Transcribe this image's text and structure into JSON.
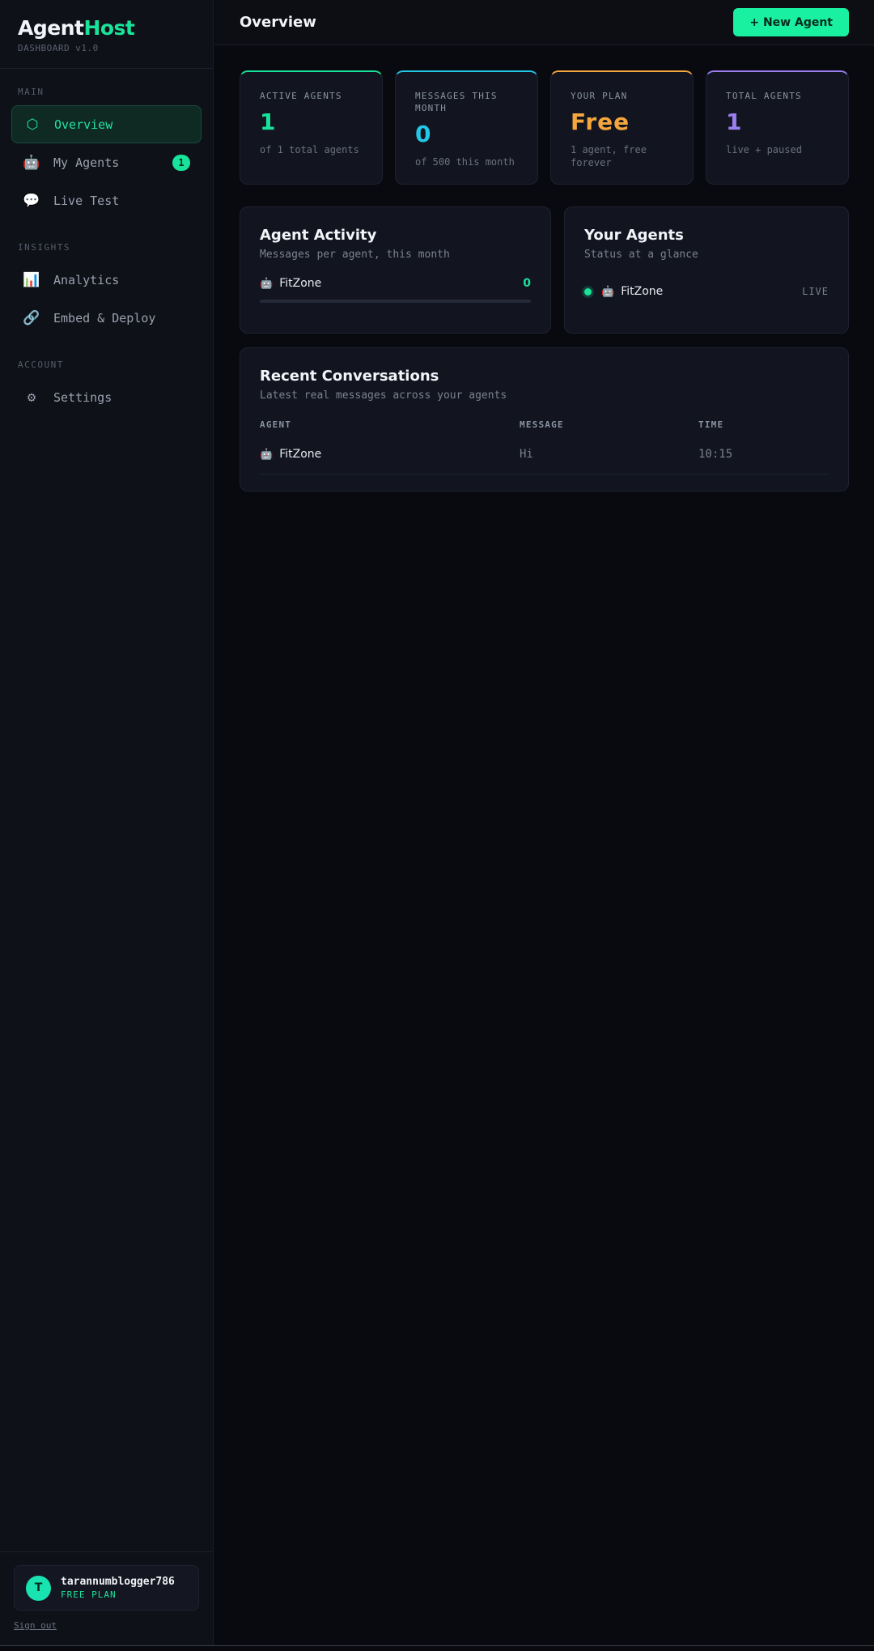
{
  "brand": {
    "name_part1": "Agent",
    "name_part2": "Host",
    "subtitle": "DASHBOARD v1.0"
  },
  "sidebar": {
    "sections": [
      {
        "label": "MAIN",
        "items": [
          {
            "label": "Overview",
            "icon": "hexagon-icon",
            "glyph": "⬡",
            "active": true
          },
          {
            "label": "My Agents",
            "icon": "robot-icon",
            "glyph": "🤖",
            "badge": "1"
          },
          {
            "label": "Live Test",
            "icon": "chat-bubble-icon",
            "glyph": "💬"
          }
        ]
      },
      {
        "label": "INSIGHTS",
        "items": [
          {
            "label": "Analytics",
            "icon": "bar-chart-icon",
            "glyph": "📊"
          },
          {
            "label": "Embed & Deploy",
            "icon": "link-icon",
            "glyph": "🔗"
          }
        ]
      },
      {
        "label": "ACCOUNT",
        "items": [
          {
            "label": "Settings",
            "icon": "gear-icon",
            "glyph": "⚙"
          }
        ]
      }
    ]
  },
  "user": {
    "initial": "T",
    "name": "tarannumblogger786",
    "plan": "FREE PLAN",
    "sign_out": "Sign out"
  },
  "topbar": {
    "title": "Overview",
    "new_agent_label": "+ New Agent"
  },
  "stats": [
    {
      "label": "ACTIVE AGENTS",
      "value": "1",
      "sub": "of 1 total agents",
      "color": "#19e39a"
    },
    {
      "label": "MESSAGES THIS MONTH",
      "value": "0",
      "sub": "of 500 this month",
      "color": "#22c8e8"
    },
    {
      "label": "YOUR PLAN",
      "value": "Free",
      "sub": "1 agent, free forever",
      "color": "#f5a63d"
    },
    {
      "label": "TOTAL AGENTS",
      "value": "1",
      "sub": "live + paused",
      "color": "#9b7ef0"
    }
  ],
  "activity": {
    "title": "Agent Activity",
    "subtitle": "Messages per agent, this month",
    "agents": [
      {
        "name": "FitZone",
        "count": "0",
        "fraction": 0
      }
    ]
  },
  "your_agents": {
    "title": "Your Agents",
    "subtitle": "Status at a glance",
    "agents": [
      {
        "name": "FitZone",
        "status": "LIVE"
      }
    ]
  },
  "conversations": {
    "title": "Recent Conversations",
    "subtitle": "Latest real messages across your agents",
    "columns": [
      "AGENT",
      "MESSAGE",
      "TIME"
    ],
    "rows": [
      {
        "agent": "FitZone",
        "message": "Hi",
        "time": "10:15"
      }
    ]
  }
}
